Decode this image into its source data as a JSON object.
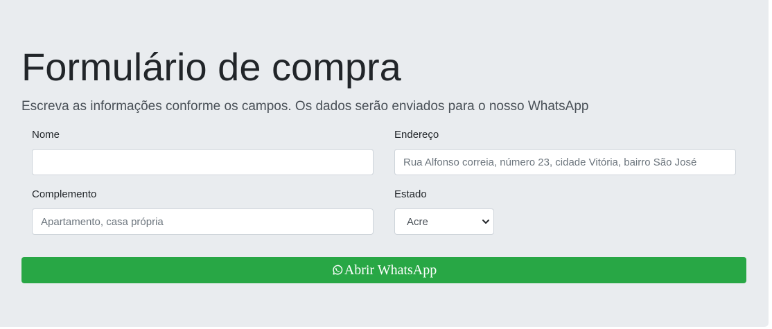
{
  "header": {
    "title": "Formulário de compra",
    "subtitle": "Escreva as informações conforme os campos. Os dados serão enviados para o nosso WhatsApp"
  },
  "form": {
    "nome": {
      "label": "Nome",
      "value": "",
      "placeholder": ""
    },
    "endereco": {
      "label": "Endereço",
      "value": "",
      "placeholder": "Rua Alfonso correia, número 23, cidade Vitória, bairro São José"
    },
    "complemento": {
      "label": "Complemento",
      "value": "",
      "placeholder": "Apartamento, casa própria"
    },
    "estado": {
      "label": "Estado",
      "selected": "Acre"
    },
    "submit": {
      "label": "Abrir WhatsApp",
      "icon": "whatsapp-icon",
      "color": "#28a745"
    }
  }
}
